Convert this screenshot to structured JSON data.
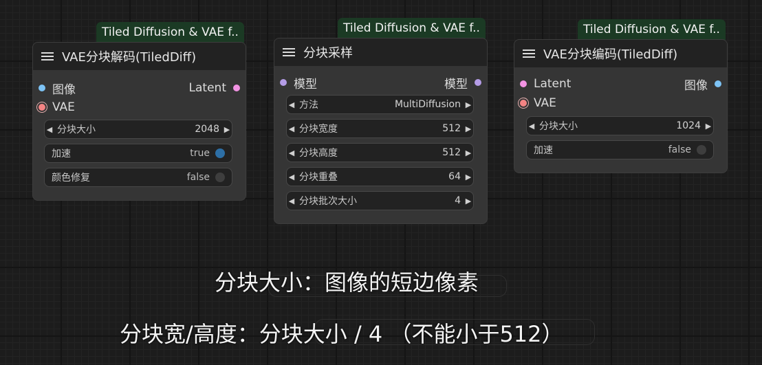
{
  "nodes": [
    {
      "badge": "Tiled Diffusion & VAE f..",
      "title": "VAE分块解码(TiledDiff)",
      "inputs": [
        "图像",
        "VAE"
      ],
      "output": "Latent",
      "widgets": [
        {
          "label": "分块大小",
          "value": "2048"
        },
        {
          "label": "加速",
          "value": "true"
        },
        {
          "label": "颜色修复",
          "value": "false"
        }
      ]
    },
    {
      "badge": "Tiled Diffusion & VAE f..",
      "title": "分块采样",
      "input": "模型",
      "output": "模型",
      "widgets": [
        {
          "label": "方法",
          "value": "MultiDiffusion"
        },
        {
          "label": "分块宽度",
          "value": "512"
        },
        {
          "label": "分块高度",
          "value": "512"
        },
        {
          "label": "分块重叠",
          "value": "64"
        },
        {
          "label": "分块批次大小",
          "value": "4"
        }
      ]
    },
    {
      "badge": "Tiled Diffusion & VAE f..",
      "title": "VAE分块编码(TiledDiff)",
      "inputs": [
        "Latent",
        "VAE"
      ],
      "output": "图像",
      "widgets": [
        {
          "label": "分块大小",
          "value": "1024"
        },
        {
          "label": "加速",
          "value": "false"
        }
      ]
    }
  ],
  "captions": [
    "分块大小：图像的短边像素",
    "分块宽/高度：分块大小 / 4 （不能小于512）"
  ],
  "colors": {
    "badge_bg": "#1b3a24",
    "node_bg": "#353535",
    "header_bg": "#222222",
    "toggle_on": "#2d6fa6"
  },
  "icons": {
    "menu": "hamburger-menu-icon",
    "left": "left-arrow-icon",
    "right": "right-arrow-icon"
  }
}
